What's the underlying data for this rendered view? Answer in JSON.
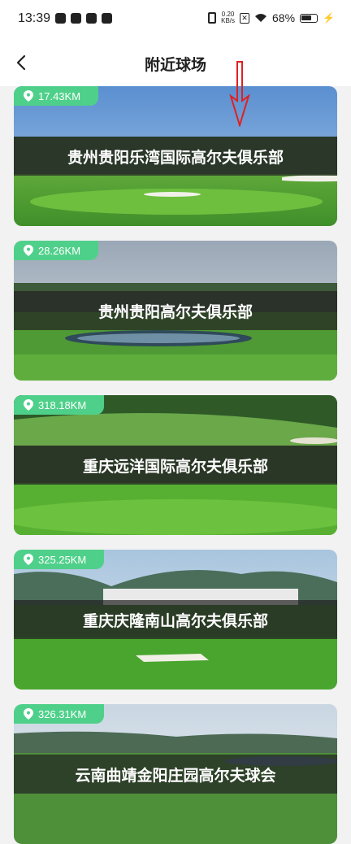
{
  "status_bar": {
    "time": "13:39",
    "net_speed_value": "0.20",
    "net_speed_unit": "KB/s",
    "battery_percent": "68%",
    "battery_level": 0.68
  },
  "header": {
    "title": "附近球场"
  },
  "courses": [
    {
      "distance": "17.43KM",
      "name": "贵州贵阳乐湾国际高尔夫俱乐部"
    },
    {
      "distance": "28.26KM",
      "name": "贵州贵阳高尔夫俱乐部"
    },
    {
      "distance": "318.18KM",
      "name": "重庆远洋国际高尔夫俱乐部"
    },
    {
      "distance": "325.25KM",
      "name": "重庆庆隆南山高尔夫俱乐部"
    },
    {
      "distance": "326.31KM",
      "name": "云南曲靖金阳庄园高尔夫球会"
    }
  ],
  "colors": {
    "accent_green": "#4fd08a",
    "annotation_red": "#e02020"
  }
}
